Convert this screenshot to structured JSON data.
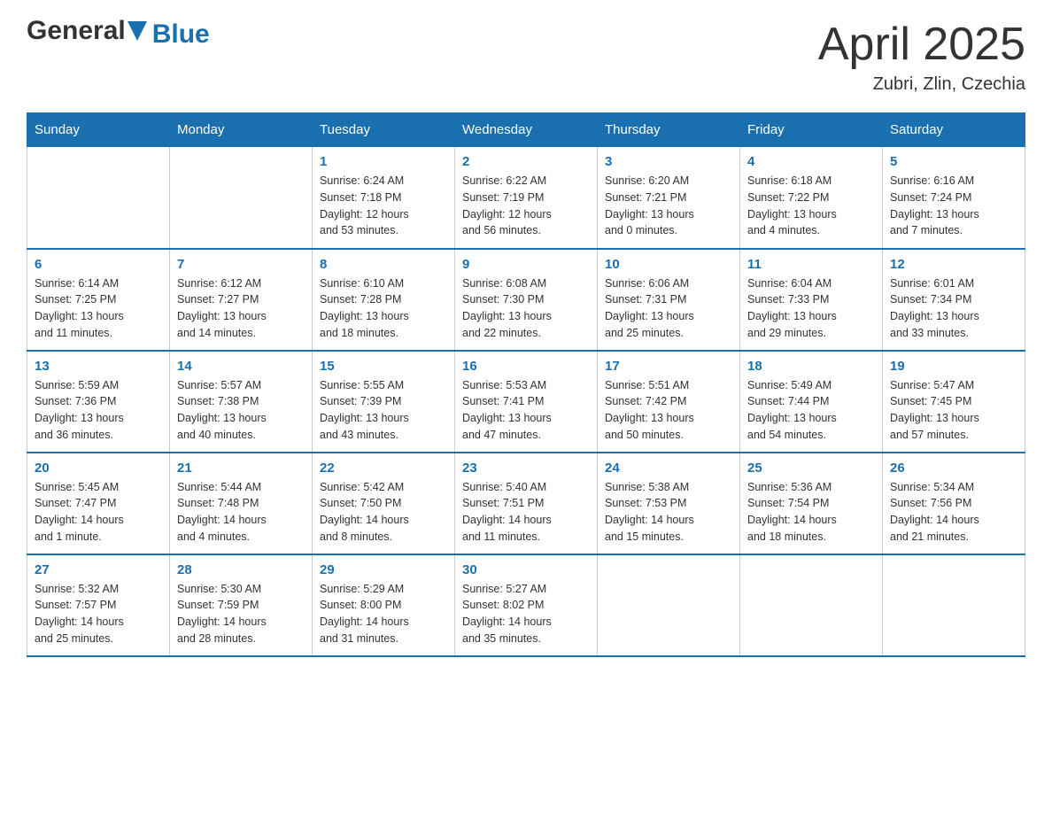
{
  "header": {
    "logo_general": "General",
    "logo_blue": "Blue",
    "title": "April 2025",
    "subtitle": "Zubri, Zlin, Czechia"
  },
  "weekdays": [
    "Sunday",
    "Monday",
    "Tuesday",
    "Wednesday",
    "Thursday",
    "Friday",
    "Saturday"
  ],
  "weeks": [
    [
      {
        "day": "",
        "info": ""
      },
      {
        "day": "",
        "info": ""
      },
      {
        "day": "1",
        "info": "Sunrise: 6:24 AM\nSunset: 7:18 PM\nDaylight: 12 hours\nand 53 minutes."
      },
      {
        "day": "2",
        "info": "Sunrise: 6:22 AM\nSunset: 7:19 PM\nDaylight: 12 hours\nand 56 minutes."
      },
      {
        "day": "3",
        "info": "Sunrise: 6:20 AM\nSunset: 7:21 PM\nDaylight: 13 hours\nand 0 minutes."
      },
      {
        "day": "4",
        "info": "Sunrise: 6:18 AM\nSunset: 7:22 PM\nDaylight: 13 hours\nand 4 minutes."
      },
      {
        "day": "5",
        "info": "Sunrise: 6:16 AM\nSunset: 7:24 PM\nDaylight: 13 hours\nand 7 minutes."
      }
    ],
    [
      {
        "day": "6",
        "info": "Sunrise: 6:14 AM\nSunset: 7:25 PM\nDaylight: 13 hours\nand 11 minutes."
      },
      {
        "day": "7",
        "info": "Sunrise: 6:12 AM\nSunset: 7:27 PM\nDaylight: 13 hours\nand 14 minutes."
      },
      {
        "day": "8",
        "info": "Sunrise: 6:10 AM\nSunset: 7:28 PM\nDaylight: 13 hours\nand 18 minutes."
      },
      {
        "day": "9",
        "info": "Sunrise: 6:08 AM\nSunset: 7:30 PM\nDaylight: 13 hours\nand 22 minutes."
      },
      {
        "day": "10",
        "info": "Sunrise: 6:06 AM\nSunset: 7:31 PM\nDaylight: 13 hours\nand 25 minutes."
      },
      {
        "day": "11",
        "info": "Sunrise: 6:04 AM\nSunset: 7:33 PM\nDaylight: 13 hours\nand 29 minutes."
      },
      {
        "day": "12",
        "info": "Sunrise: 6:01 AM\nSunset: 7:34 PM\nDaylight: 13 hours\nand 33 minutes."
      }
    ],
    [
      {
        "day": "13",
        "info": "Sunrise: 5:59 AM\nSunset: 7:36 PM\nDaylight: 13 hours\nand 36 minutes."
      },
      {
        "day": "14",
        "info": "Sunrise: 5:57 AM\nSunset: 7:38 PM\nDaylight: 13 hours\nand 40 minutes."
      },
      {
        "day": "15",
        "info": "Sunrise: 5:55 AM\nSunset: 7:39 PM\nDaylight: 13 hours\nand 43 minutes."
      },
      {
        "day": "16",
        "info": "Sunrise: 5:53 AM\nSunset: 7:41 PM\nDaylight: 13 hours\nand 47 minutes."
      },
      {
        "day": "17",
        "info": "Sunrise: 5:51 AM\nSunset: 7:42 PM\nDaylight: 13 hours\nand 50 minutes."
      },
      {
        "day": "18",
        "info": "Sunrise: 5:49 AM\nSunset: 7:44 PM\nDaylight: 13 hours\nand 54 minutes."
      },
      {
        "day": "19",
        "info": "Sunrise: 5:47 AM\nSunset: 7:45 PM\nDaylight: 13 hours\nand 57 minutes."
      }
    ],
    [
      {
        "day": "20",
        "info": "Sunrise: 5:45 AM\nSunset: 7:47 PM\nDaylight: 14 hours\nand 1 minute."
      },
      {
        "day": "21",
        "info": "Sunrise: 5:44 AM\nSunset: 7:48 PM\nDaylight: 14 hours\nand 4 minutes."
      },
      {
        "day": "22",
        "info": "Sunrise: 5:42 AM\nSunset: 7:50 PM\nDaylight: 14 hours\nand 8 minutes."
      },
      {
        "day": "23",
        "info": "Sunrise: 5:40 AM\nSunset: 7:51 PM\nDaylight: 14 hours\nand 11 minutes."
      },
      {
        "day": "24",
        "info": "Sunrise: 5:38 AM\nSunset: 7:53 PM\nDaylight: 14 hours\nand 15 minutes."
      },
      {
        "day": "25",
        "info": "Sunrise: 5:36 AM\nSunset: 7:54 PM\nDaylight: 14 hours\nand 18 minutes."
      },
      {
        "day": "26",
        "info": "Sunrise: 5:34 AM\nSunset: 7:56 PM\nDaylight: 14 hours\nand 21 minutes."
      }
    ],
    [
      {
        "day": "27",
        "info": "Sunrise: 5:32 AM\nSunset: 7:57 PM\nDaylight: 14 hours\nand 25 minutes."
      },
      {
        "day": "28",
        "info": "Sunrise: 5:30 AM\nSunset: 7:59 PM\nDaylight: 14 hours\nand 28 minutes."
      },
      {
        "day": "29",
        "info": "Sunrise: 5:29 AM\nSunset: 8:00 PM\nDaylight: 14 hours\nand 31 minutes."
      },
      {
        "day": "30",
        "info": "Sunrise: 5:27 AM\nSunset: 8:02 PM\nDaylight: 14 hours\nand 35 minutes."
      },
      {
        "day": "",
        "info": ""
      },
      {
        "day": "",
        "info": ""
      },
      {
        "day": "",
        "info": ""
      }
    ]
  ]
}
